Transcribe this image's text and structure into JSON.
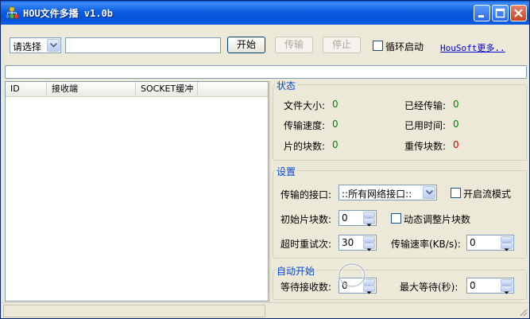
{
  "window": {
    "title": "HOU文件多播 v1.0b"
  },
  "toolbar": {
    "select_value": "请选择",
    "path_value": "",
    "start_label": "开始",
    "transfer_label": "传输",
    "stop_label": "停止",
    "loop_label": "循环启动",
    "link_label": "HouSoft更多.."
  },
  "list": {
    "columns": [
      "ID",
      "接收端",
      "SOCKET缓冲"
    ]
  },
  "status": {
    "title": "状态",
    "file_size_label": "文件大小:",
    "file_size_value": "0",
    "transferred_label": "已经传输:",
    "transferred_value": "0",
    "speed_label": "传输速度:",
    "speed_value": "0",
    "elapsed_label": "已用时间:",
    "elapsed_value": "0",
    "blocks_label": "片的块数:",
    "blocks_value": "0",
    "resend_label": "重传块数:",
    "resend_value": "0"
  },
  "settings": {
    "title": "设置",
    "interface_label": "传输的接口:",
    "interface_value": "::所有网络接口::",
    "stream_label": "开启流模式",
    "init_blocks_label": "初始片块数:",
    "init_blocks_value": "0",
    "dynamic_label": "动态调整片块数",
    "retry_label": "超时重试次:",
    "retry_value": "30",
    "rate_label": "传输速率(KB/s):",
    "rate_value": "0"
  },
  "auto": {
    "title": "自动开始",
    "wait_recv_label": "等待接收数:",
    "wait_recv_value": "0",
    "max_wait_label": "最大等待(秒):",
    "max_wait_value": "0"
  },
  "colors": {
    "title_bar": "#0653d6",
    "value_ok": "#008000",
    "value_warn": "#e00000",
    "group_title": "#0046d5"
  }
}
